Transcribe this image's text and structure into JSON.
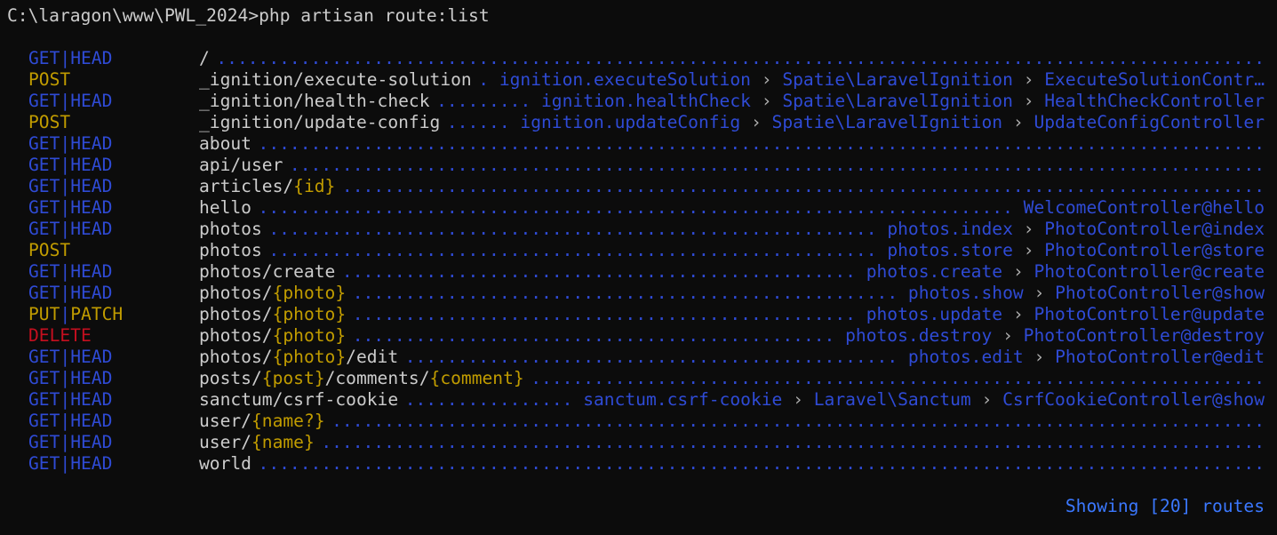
{
  "prompt": "C:\\laragon\\www\\PWL_2024>php artisan route:list",
  "routes": [
    {
      "method": [
        "GET",
        "HEAD"
      ],
      "method_color": "blue",
      "uri": [
        "/"
      ],
      "handler": []
    },
    {
      "method": [
        "POST"
      ],
      "method_color": "yellow",
      "uri": [
        "_ignition/execute-solution"
      ],
      "handler": [
        "ignition.executeSolution",
        "Spatie\\LaravelIgnition",
        "ExecuteSolutionContr…"
      ]
    },
    {
      "method": [
        "GET",
        "HEAD"
      ],
      "method_color": "blue",
      "uri": [
        "_ignition/health-check"
      ],
      "handler": [
        "ignition.healthCheck",
        "Spatie\\LaravelIgnition",
        "HealthCheckController"
      ]
    },
    {
      "method": [
        "POST"
      ],
      "method_color": "yellow",
      "uri": [
        "_ignition/update-config"
      ],
      "handler": [
        "ignition.updateConfig",
        "Spatie\\LaravelIgnition",
        "UpdateConfigController"
      ]
    },
    {
      "method": [
        "GET",
        "HEAD"
      ],
      "method_color": "blue",
      "uri": [
        "about"
      ],
      "handler": []
    },
    {
      "method": [
        "GET",
        "HEAD"
      ],
      "method_color": "blue",
      "uri": [
        "api/user"
      ],
      "handler": []
    },
    {
      "method": [
        "GET",
        "HEAD"
      ],
      "method_color": "blue",
      "uri": [
        "articles/",
        "{id}"
      ],
      "handler": []
    },
    {
      "method": [
        "GET",
        "HEAD"
      ],
      "method_color": "blue",
      "uri": [
        "hello"
      ],
      "handler": [
        "WelcomeController@hello"
      ]
    },
    {
      "method": [
        "GET",
        "HEAD"
      ],
      "method_color": "blue",
      "uri": [
        "photos"
      ],
      "handler": [
        "photos.index",
        "PhotoController@index"
      ]
    },
    {
      "method": [
        "POST"
      ],
      "method_color": "yellow",
      "uri": [
        "photos"
      ],
      "handler": [
        "photos.store",
        "PhotoController@store"
      ]
    },
    {
      "method": [
        "GET",
        "HEAD"
      ],
      "method_color": "blue",
      "uri": [
        "photos/create"
      ],
      "handler": [
        "photos.create",
        "PhotoController@create"
      ]
    },
    {
      "method": [
        "GET",
        "HEAD"
      ],
      "method_color": "blue",
      "uri": [
        "photos/",
        "{photo}"
      ],
      "handler": [
        "photos.show",
        "PhotoController@show"
      ]
    },
    {
      "method": [
        "PUT",
        "PATCH"
      ],
      "method_color": "yellow",
      "uri": [
        "photos/",
        "{photo}"
      ],
      "handler": [
        "photos.update",
        "PhotoController@update"
      ]
    },
    {
      "method": [
        "DELETE"
      ],
      "method_color": "red",
      "uri": [
        "photos/",
        "{photo}"
      ],
      "handler": [
        "photos.destroy",
        "PhotoController@destroy"
      ]
    },
    {
      "method": [
        "GET",
        "HEAD"
      ],
      "method_color": "blue",
      "uri": [
        "photos/",
        "{photo}",
        "/edit"
      ],
      "handler": [
        "photos.edit",
        "PhotoController@edit"
      ]
    },
    {
      "method": [
        "GET",
        "HEAD"
      ],
      "method_color": "blue",
      "uri": [
        "posts/",
        "{post}",
        "/comments/",
        "{comment}"
      ],
      "handler": []
    },
    {
      "method": [
        "GET",
        "HEAD"
      ],
      "method_color": "blue",
      "uri": [
        "sanctum/csrf-cookie"
      ],
      "handler": [
        "sanctum.csrf-cookie",
        "Laravel\\Sanctum",
        "CsrfCookieController@show"
      ]
    },
    {
      "method": [
        "GET",
        "HEAD"
      ],
      "method_color": "blue",
      "uri": [
        "user/",
        "{name?}"
      ],
      "handler": []
    },
    {
      "method": [
        "GET",
        "HEAD"
      ],
      "method_color": "blue",
      "uri": [
        "user/",
        "{name}"
      ],
      "handler": []
    },
    {
      "method": [
        "GET",
        "HEAD"
      ],
      "method_color": "blue",
      "uri": [
        "world"
      ],
      "handler": []
    }
  ],
  "method_separator": "|",
  "handler_separator": "›",
  "footer": "Showing [20] routes",
  "colors": {
    "background": "#0c0c0c",
    "text": "#cccccc",
    "blue": "#2f4bd6",
    "yellow": "#c19c00",
    "red": "#c50f1f",
    "footer": "#3b78ff"
  }
}
